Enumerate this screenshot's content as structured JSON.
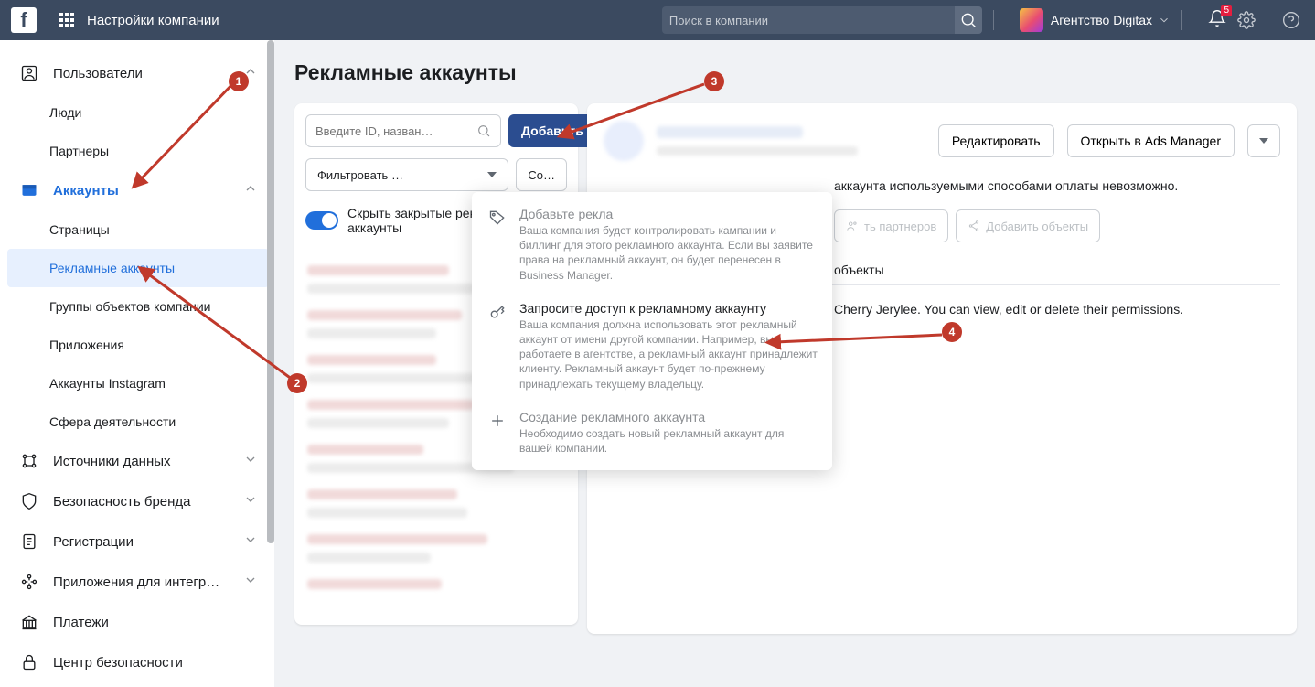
{
  "topbar": {
    "title": "Настройки компании",
    "search_placeholder": "Поиск в компании",
    "agency_name": "Агентство Digitax",
    "notification_count": "5"
  },
  "sidebar": {
    "users_section": "Пользователи",
    "users_people": "Люди",
    "users_partners": "Партнеры",
    "accounts_section": "Аккаунты",
    "accounts_pages": "Страницы",
    "accounts_ad": "Рекламные аккаунты",
    "accounts_groups": "Группы объектов компании",
    "accounts_apps": "Приложения",
    "accounts_instagram": "Аккаунты Instagram",
    "accounts_sphere": "Сфера деятельности",
    "data_sources": "Источники данных",
    "brand_safety": "Безопасность бренда",
    "registrations": "Регистрации",
    "integrations": "Приложения для интегр…",
    "payments": "Платежи",
    "security_center": "Центр безопасности"
  },
  "main": {
    "page_title": "Рекламные аккаунты",
    "search_placeholder": "Введите ID, назван…",
    "add_btn": "Добавить",
    "filter_btn": "Фильтровать …",
    "sort_btn": "Со…",
    "hide_closed_label": "Скрыть закрытые рекламные аккаунты",
    "edit_btn": "Редактировать",
    "open_ads_btn": "Открыть в Ads Manager",
    "payment_warning": "аккаунта используемыми способами оплаты невозможно.",
    "assign_partners": "ть партнеров",
    "add_assets": "Добавить объекты",
    "connected_assets": "объекты",
    "shared_by": "Cherry Jerylee. You can view, edit or delete their permissions."
  },
  "dropdown": {
    "item1_title": "Добавьте рекла",
    "item1_desc": "Ваша компания будет контролировать кампании и биллинг для этого рекламного аккаунта. Если вы заявите права на рекламный аккаунт, он будет перенесен в Business Manager.",
    "item2_title": "Запросите доступ к рекламному аккаунту",
    "item2_desc": "Ваша компания должна использовать этот рекламный аккаунт от имени другой компании. Например, вы работаете в агентстве, а рекламный аккаунт принадлежит клиенту. Рекламный аккаунт будет по-прежнему принадлежать текущему владельцу.",
    "item3_title": "Создание рекламного аккаунта",
    "item3_desc": "Необходимо создать новый рекламный аккаунт для вашей компании."
  },
  "annotations": {
    "n1": "1",
    "n2": "2",
    "n3": "3",
    "n4": "4"
  }
}
